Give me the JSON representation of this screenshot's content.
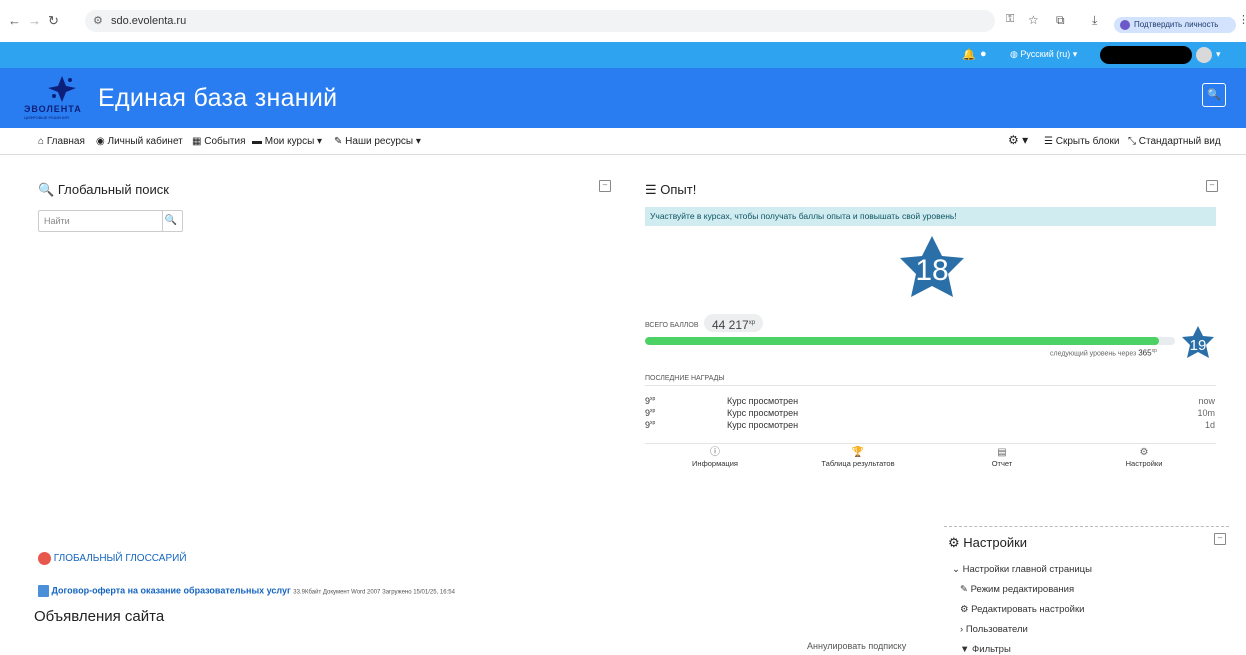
{
  "browser": {
    "url": "sdo.evolenta.ru",
    "identity_chip": "Подтвердить личность"
  },
  "topbar": {
    "language": "Русский (ru)"
  },
  "site": {
    "logo_text": "ЭВОЛЕНТА",
    "logo_sub": "ЦИФРОВЫЕ РЕШЕНИЯ",
    "name": "Единая база знаний"
  },
  "nav": {
    "items": [
      "Главная",
      "Личный кабинет",
      "События",
      "Мои курсы",
      "Наши ресурсы"
    ],
    "hide_blocks": "Скрыть блоки",
    "standard_view": "Стандартный вид"
  },
  "search_block": {
    "title": "Глобальный поиск",
    "placeholder": "Найти"
  },
  "xp_block": {
    "title": "Опыт!",
    "notice": "Участвуйте в курсах, чтобы получать баллы опыта и повышать свой уровень!",
    "level": "18",
    "total_label": "ВСЕГО БАЛЛОВ",
    "total_value": "44 217",
    "xp_unit": "xp",
    "progress_fraction": 0.97,
    "next_level_text": "следующий уровень через",
    "next_level_value": "365",
    "next_level": "19",
    "recent_label": "ПОСЛЕДНИЕ НАГРАДЫ",
    "rewards": [
      {
        "points": "9",
        "text": "Курс просмотрен",
        "time": "now"
      },
      {
        "points": "9",
        "text": "Курс просмотрен",
        "time": "10m"
      },
      {
        "points": "9",
        "text": "Курс просмотрен",
        "time": "1d"
      }
    ],
    "footer": [
      "Информация",
      "Таблица результатов",
      "Отчет",
      "Настройки"
    ]
  },
  "glossary": {
    "title": "ГЛОБАЛЬНЫЙ ГЛОССАРИЙ"
  },
  "document": {
    "link": "Договор-оферта на оказание образовательных услуг",
    "meta": "33.9Кбайт Документ Word 2007 Загружено 15/01/25, 16:54"
  },
  "announcements": {
    "title": "Объявления сайта",
    "unsubscribe": "Аннулировать подписку"
  },
  "settings_block": {
    "title": "Настройки",
    "main_settings": "Настройки главной страницы",
    "items": [
      "Режим редактирования",
      "Редактировать настройки",
      "Пользователи",
      "Фильтры"
    ]
  },
  "colors": {
    "topbar": "#2ea4f0",
    "brandbar": "#2a7df0",
    "star": "#2a6fa8",
    "progress": "#4cd164",
    "link": "#1565c0"
  }
}
